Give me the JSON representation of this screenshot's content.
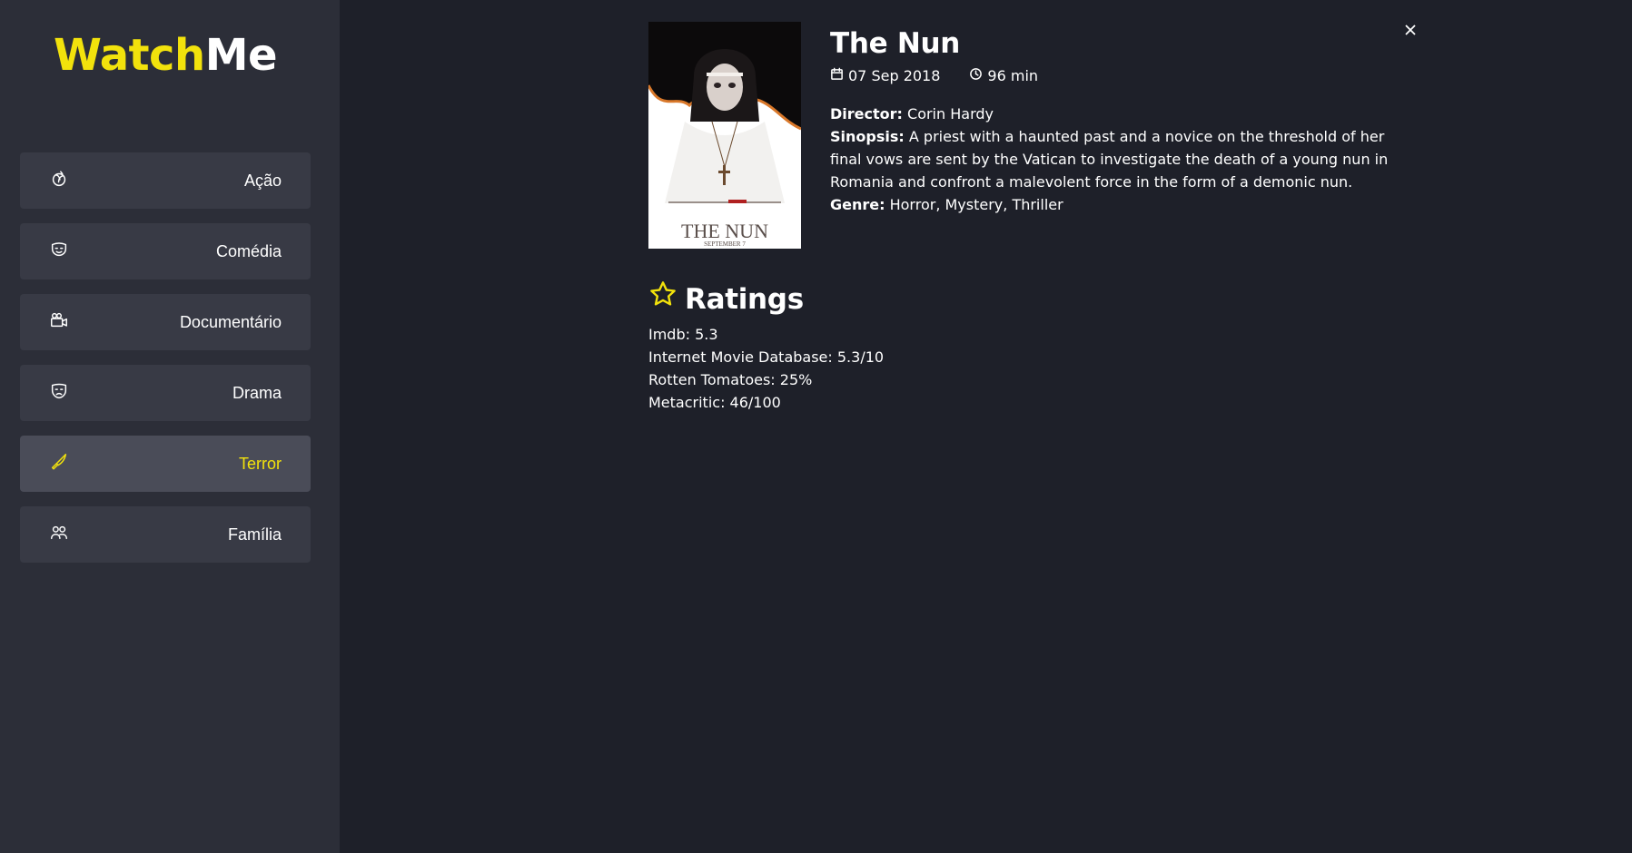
{
  "app": {
    "logo_part1": "Watch",
    "logo_part2": "Me"
  },
  "sidebar": {
    "items": [
      {
        "label": "Ação",
        "icon": "dodgeball-icon",
        "active": false
      },
      {
        "label": "Comédia",
        "icon": "mask-icon",
        "active": false
      },
      {
        "label": "Documentário",
        "icon": "camera-icon",
        "active": false
      },
      {
        "label": "Drama",
        "icon": "sad-mask-icon",
        "active": false
      },
      {
        "label": "Terror",
        "icon": "knife-icon",
        "active": true
      },
      {
        "label": "Família",
        "icon": "users-icon",
        "active": false
      }
    ]
  },
  "movie": {
    "title": "The Nun",
    "release_date": "07 Sep 2018",
    "runtime": "96 min",
    "director_label": "Director:",
    "director": "Corin Hardy",
    "synopsis_label": "Sinopsis:",
    "synopsis": "A priest with a haunted past and a novice on the threshold of her final vows are sent by the Vatican to investigate the death of a young nun in Romania and confront a malevolent force in the form of a demonic nun.",
    "genre_label": "Genre:",
    "genre": "Horror, Mystery, Thriller",
    "poster_title": "THE NUN",
    "poster_date": "SEPTEMBER 7"
  },
  "ratings": {
    "heading": "Ratings",
    "items": [
      "Imdb: 5.3",
      "Internet Movie Database: 5.3/10",
      "Rotten Tomatoes: 25%",
      "Metacritic: 46/100"
    ]
  },
  "colors": {
    "accent": "#f2e20c",
    "background": "#1e2029",
    "sidebar": "#2c2e38",
    "nav_item": "#383a45",
    "nav_item_active": "#4a4c58"
  }
}
